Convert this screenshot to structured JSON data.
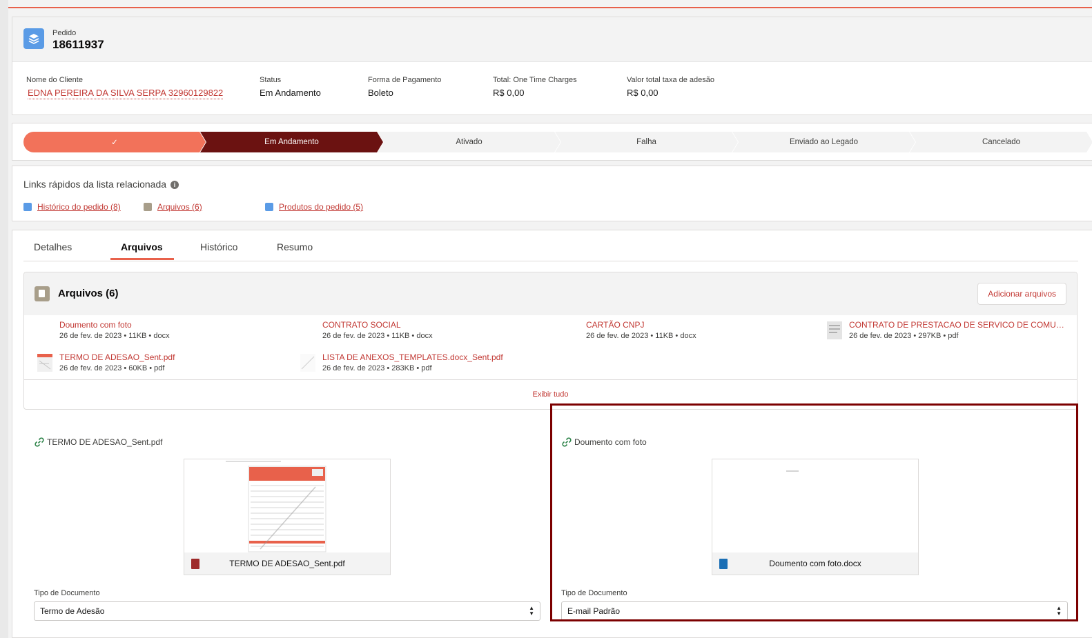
{
  "header": {
    "object_label": "Pedido",
    "record_number": "18611937",
    "fields": [
      {
        "label": "Nome do Cliente",
        "value": "EDNA PEREIRA DA SILVA SERPA 32960129822"
      },
      {
        "label": "Status",
        "value": "Em Andamento"
      },
      {
        "label": "Forma de Pagamento",
        "value": "Boleto"
      },
      {
        "label": "Total: One Time Charges",
        "value": "R$ 0,00"
      },
      {
        "label": "Valor total taxa de adesão",
        "value": "R$ 0,00"
      }
    ]
  },
  "path": {
    "steps": [
      {
        "label": "✓",
        "state": "complete"
      },
      {
        "label": "Em Andamento",
        "state": "current"
      },
      {
        "label": "Ativado",
        "state": "incomplete"
      },
      {
        "label": "Falha",
        "state": "incomplete"
      },
      {
        "label": "Enviado ao Legado",
        "state": "incomplete"
      },
      {
        "label": "Cancelado",
        "state": "incomplete"
      }
    ]
  },
  "quick_links": {
    "title": "Links rápidos da lista relacionada",
    "info_glyph": "i",
    "links": [
      {
        "label": "Histórico do pedido (8)",
        "icon": "order-history-icon",
        "color": "#5a9be6"
      },
      {
        "label": "Arquivos (6)",
        "icon": "files-icon",
        "color": "#a89e8a"
      },
      {
        "label": "Produtos do pedido (5)",
        "icon": "order-products-icon",
        "color": "#5a9be6"
      }
    ]
  },
  "tabs": [
    {
      "label": "Detalhes",
      "active": false
    },
    {
      "label": "Arquivos",
      "active": true
    },
    {
      "label": "Histórico",
      "active": false
    },
    {
      "label": "Resumo",
      "active": false
    }
  ],
  "files_card": {
    "title": "Arquivos (6)",
    "add_button": "Adicionar arquivos",
    "view_all": "Exibir tudo",
    "files": [
      {
        "name": "Doumento com foto",
        "meta": "26 de fev. de 2023 • 11KB • docx"
      },
      {
        "name": "CONTRATO SOCIAL",
        "meta": "26 de fev. de 2023 • 11KB • docx"
      },
      {
        "name": "CARTÃO CNPJ",
        "meta": "26 de fev. de 2023 • 11KB • docx"
      },
      {
        "name": "CONTRATO DE PRESTACAO DE SERVICO DE COMUNICA...",
        "meta": "26 de fev. de 2023 • 297KB • pdf"
      },
      {
        "name": "TERMO DE ADESAO_Sent.pdf",
        "meta": "26 de fev. de 2023 • 60KB • pdf"
      },
      {
        "name": "LISTA DE ANEXOS_TEMPLATES.docx_Sent.pdf",
        "meta": "26 de fev. de 2023 • 283KB • pdf"
      }
    ]
  },
  "attachments": [
    {
      "title": "TERMO DE ADESAO_Sent.pdf",
      "preview_name": "TERMO DE ADESAO_Sent.pdf",
      "file_icon_color": "#9e2a2a",
      "doc_type_label": "Tipo de Documento",
      "doc_type_value": "Termo de Adesão"
    },
    {
      "title": "Doumento com foto",
      "preview_name": "Doumento com foto.docx",
      "file_icon_color": "#1b6fb5",
      "doc_type_label": "Tipo de Documento",
      "doc_type_value": "E-mail Padrão"
    }
  ],
  "colors": {
    "brand_accent": "#e8614b",
    "path_complete": "#f2725a",
    "path_current": "#6b1211",
    "link": "#c23934",
    "highlight_box": "#7c0000"
  }
}
